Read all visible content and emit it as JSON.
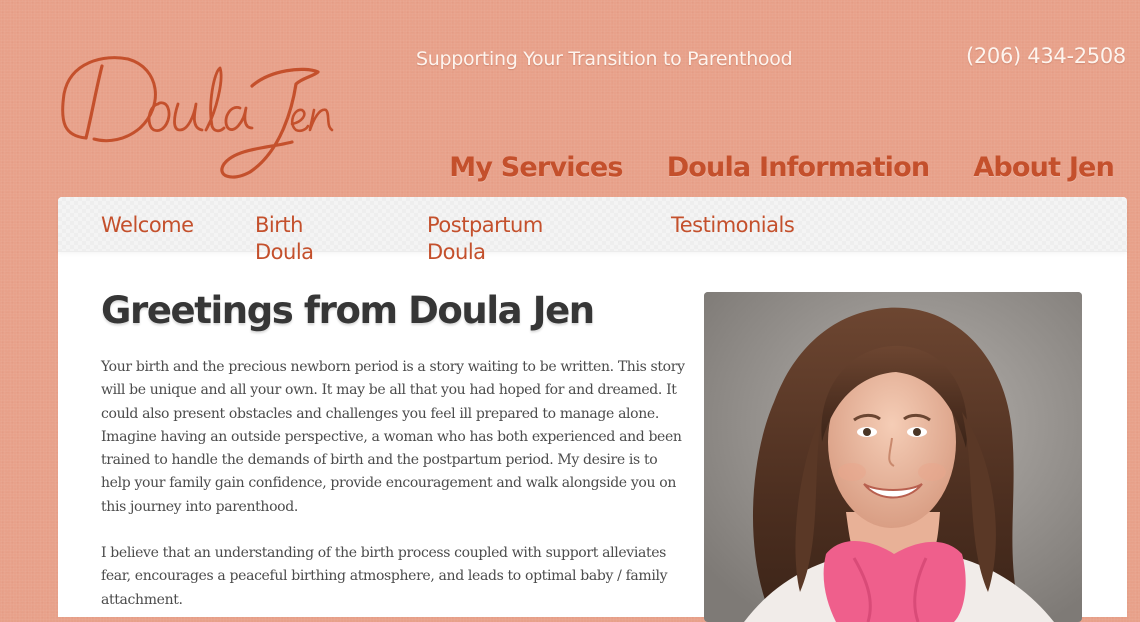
{
  "header": {
    "logo_text": "DoulaJen",
    "tagline": "Supporting Your Transition to Parenthood",
    "phone": "(206) 434-2508"
  },
  "main_nav": {
    "items": [
      {
        "label": "My Services"
      },
      {
        "label": "Doula Information"
      },
      {
        "label": "About Jen"
      }
    ]
  },
  "sub_nav": {
    "items": [
      {
        "label": "Welcome"
      },
      {
        "label": "Birth\nDoula"
      },
      {
        "label": "Postpartum\nDoula"
      },
      {
        "label": "Testimonials"
      }
    ]
  },
  "content": {
    "title": "Greetings from Doula Jen",
    "paragraph1": "Your birth and the precious newborn period is a story waiting to be written. This story will be unique and all your own. It may be all that you had hoped for and dreamed. It could also present obstacles and challenges you feel ill prepared to manage alone. Imagine having an outside perspective, a woman who has both experienced and been trained to handle the demands of birth and the postpartum period. My desire is to help your family gain confidence, provide encouragement and walk alongside you on this journey into parenthood.",
    "paragraph2": "I believe that an understanding of the birth process coupled with support alleviates fear, encourages a peaceful birthing atmosphere, and leads to optimal baby / family attachment."
  },
  "photo": {
    "icon": "portrait-photo"
  },
  "colors": {
    "background": "#e8a18a",
    "accent": "#c4502c",
    "heading": "#363636",
    "body_text": "#4b4b4b",
    "header_text": "#fdf4ee"
  }
}
